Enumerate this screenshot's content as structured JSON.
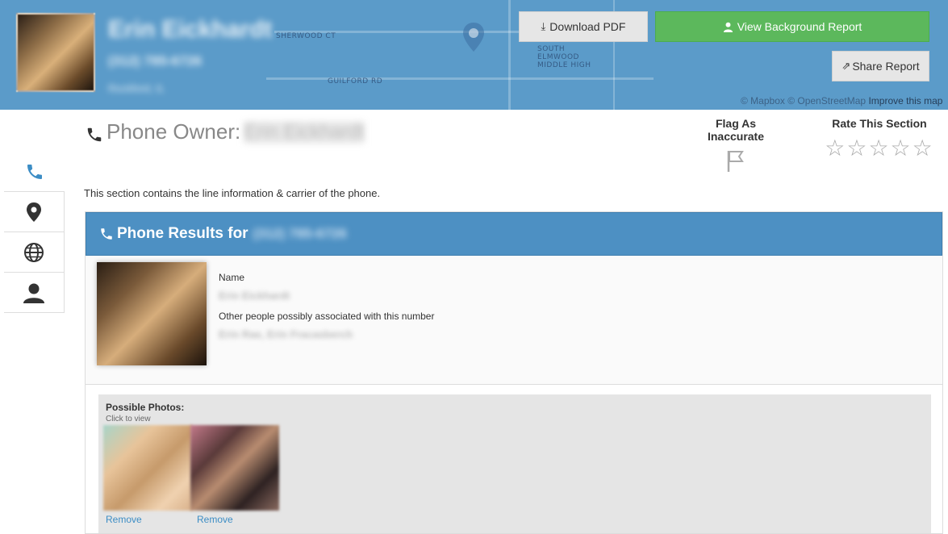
{
  "header": {
    "name": "Erin Eickhardt",
    "phone": "(312) 785-6726",
    "location": "Rockford, IL",
    "map_labels": [
      "SHERWOOD CT",
      "SOUTH ELMWOOD MIDDLE HIGH",
      "GUILFORD RD"
    ],
    "attribution": "© Mapbox © OpenStreetMap",
    "attribution_link": "Improve this map"
  },
  "toolbar": {
    "download_label": "Download PDF",
    "background_label": "View Background Report",
    "share_label": "Share Report"
  },
  "section": {
    "title": "Phone Owner:",
    "owner_name": "Erin Eickhardt",
    "flag_label": "Flag As Inaccurate",
    "rate_label": "Rate This Section",
    "stars": "☆☆☆☆☆",
    "description": "This section contains the line information & carrier of the phone."
  },
  "panel": {
    "title": "Phone Results for",
    "phone": "(312) 785-6726",
    "name_label": "Name",
    "name_value": "Erin Eickhardt",
    "associated_label": "Other people possibly associated with this number",
    "associated_value": "Erin Rae, Erin Fracasberch"
  },
  "photos": {
    "title": "Possible Photos:",
    "hint": "Click to view",
    "remove_label": "Remove"
  },
  "colors": {
    "banner": "#5b9bc9",
    "primary_green": "#5cb85c",
    "panel_head": "#4d90c3",
    "link": "#3c8dc5"
  }
}
